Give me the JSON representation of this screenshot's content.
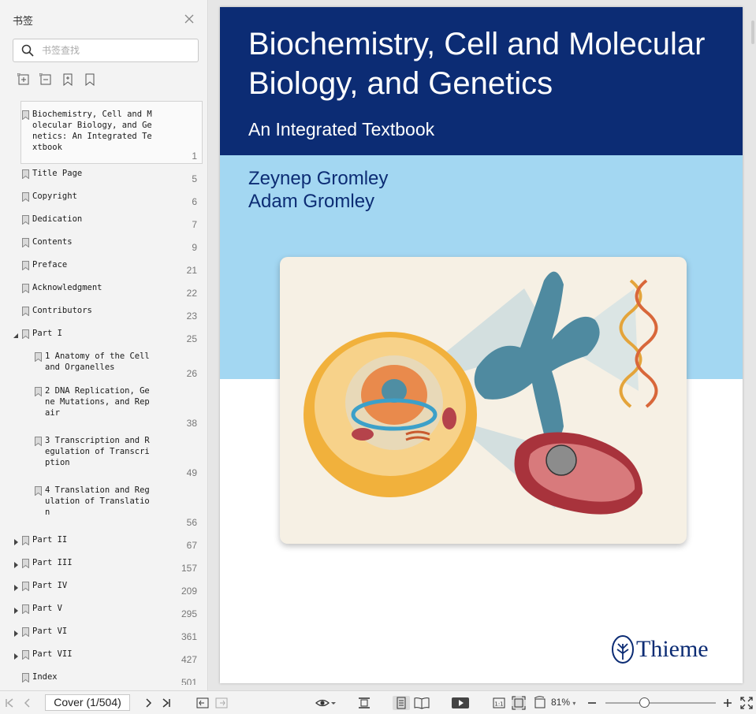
{
  "sidebar": {
    "title": "书签",
    "search_placeholder": "书签查找",
    "tools": [
      "expand-all-icon",
      "collapse-all-icon",
      "add-bookmark-icon",
      "bookmark-icon"
    ]
  },
  "bookmarks": [
    {
      "label": "Biochemistry, Cell and M\nolecular Biology, and Ge\nnetics: An Integrated Te\nxtbook",
      "page": "1",
      "level": 0,
      "selected": true
    },
    {
      "label": "Title Page",
      "page": "5",
      "level": 0
    },
    {
      "label": "Copyright",
      "page": "6",
      "level": 0
    },
    {
      "label": "Dedication",
      "page": "7",
      "level": 0
    },
    {
      "label": "Contents",
      "page": "9",
      "level": 0
    },
    {
      "label": "Preface",
      "page": "21",
      "level": 0
    },
    {
      "label": "Acknowledgment",
      "page": "22",
      "level": 0
    },
    {
      "label": "Contributors",
      "page": "23",
      "level": 0
    },
    {
      "label": "Part I",
      "page": "25",
      "level": 0,
      "expander": "expanded"
    },
    {
      "label": "1 Anatomy of the Cell\nand Organelles",
      "page": "26",
      "level": 1
    },
    {
      "label": "2 DNA Replication, Ge\nne Mutations, and Rep\nair",
      "page": "38",
      "level": 1
    },
    {
      "label": "3 Transcription and R\negulation of Transcri\nption",
      "page": "49",
      "level": 1
    },
    {
      "label": "4 Translation and Reg\nulation of Translatio\nn",
      "page": "56",
      "level": 1
    },
    {
      "label": "Part II",
      "page": "67",
      "level": 0,
      "expander": "collapsed"
    },
    {
      "label": "Part III",
      "page": "157",
      "level": 0,
      "expander": "collapsed"
    },
    {
      "label": "Part IV",
      "page": "209",
      "level": 0,
      "expander": "collapsed"
    },
    {
      "label": "Part V",
      "page": "295",
      "level": 0,
      "expander": "collapsed"
    },
    {
      "label": "Part VI",
      "page": "361",
      "level": 0,
      "expander": "collapsed"
    },
    {
      "label": "Part VII",
      "page": "427",
      "level": 0,
      "expander": "collapsed"
    },
    {
      "label": "Index",
      "page": "501",
      "level": 0
    }
  ],
  "cover": {
    "title": "Biochemistry, Cell and Molecular Biology, and Genetics",
    "subtitle": "An Integrated Textbook",
    "authors": [
      "Zeynep Gromley",
      "Adam Gromley"
    ],
    "publisher": "Thieme",
    "colors": {
      "navy": "#0c2c74",
      "sky": "#a3d7f2"
    }
  },
  "toolbar": {
    "page_indicator": "Cover (1/504)",
    "zoom": "81%",
    "zoom_value": 0.35
  }
}
